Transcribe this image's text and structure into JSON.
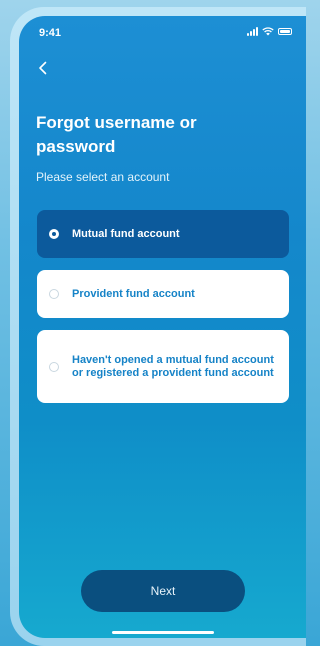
{
  "status_bar": {
    "time": "9:41",
    "icons": [
      "cellular-signal-icon",
      "wifi-icon",
      "battery-icon"
    ]
  },
  "nav": {
    "back_icon": "chevron-left-icon"
  },
  "header": {
    "title": "Forgot username or password",
    "subtitle": "Please select an account"
  },
  "options": [
    {
      "label": "Mutual fund account",
      "selected": true
    },
    {
      "label": "Provident fund account",
      "selected": false
    },
    {
      "label": "Haven't opened a mutual fund account or registered a provident fund account",
      "selected": false
    }
  ],
  "footer": {
    "next_label": "Next"
  },
  "colors": {
    "screen_gradient_top": "#1d8fd4",
    "screen_gradient_bottom": "#16a9cf",
    "selected_option_bg": "#0c5a9c",
    "option_text": "#1683c7",
    "next_button_bg": "#0a4f7f"
  }
}
